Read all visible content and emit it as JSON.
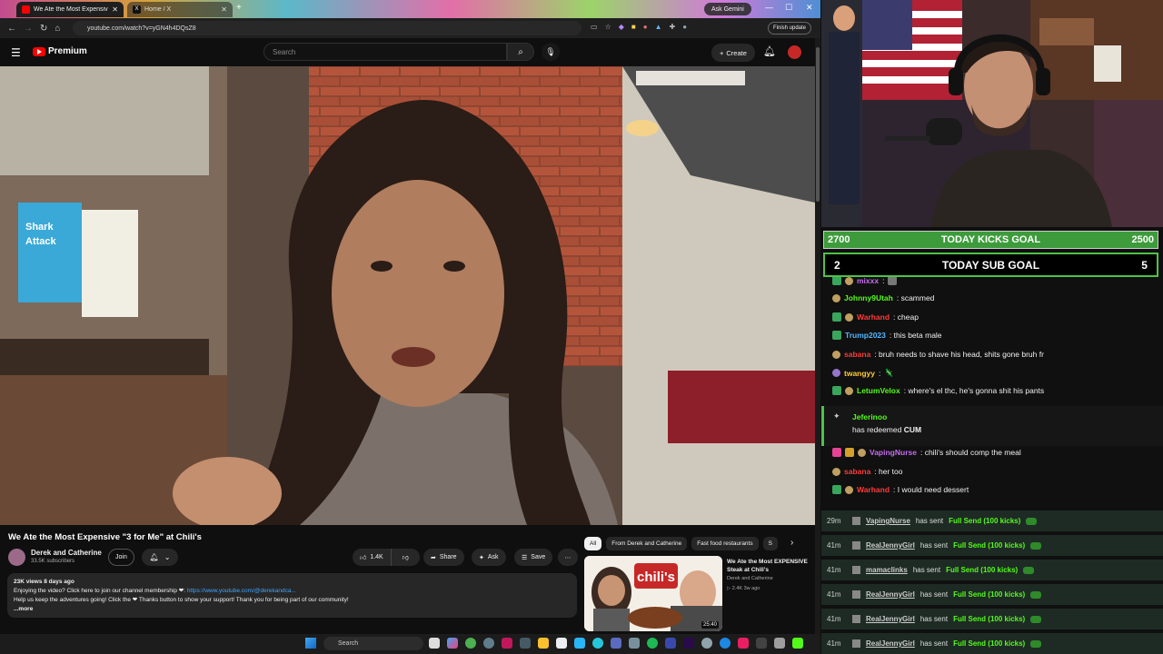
{
  "browser": {
    "tabs": [
      {
        "title": "We Ate the Most Expensive",
        "favicon_color": "#ff0000",
        "active": true
      },
      {
        "title": "Home / X",
        "favicon_color": "#222222",
        "active": false
      }
    ],
    "gemini_label": "Ask Gemini",
    "url": "youtube.com/watch?v=yGN4h4DQsZ8",
    "finish_update": "Finish update"
  },
  "youtube": {
    "logo_text": "Premium",
    "search_placeholder": "Search",
    "create_label": "Create",
    "video": {
      "title": "We Ate the Most Expensive \"3 for Me\" at Chili's",
      "channel": "Derek and Catherine",
      "subscribers": "33.5K subscribers",
      "join_label": "Join",
      "likes": "1.4K",
      "share_label": "Share",
      "ask_label": "Ask",
      "save_label": "Save"
    },
    "description": {
      "meta": "23K views  8 days ago",
      "line1_prefix": "Enjoying the video? Click here to join our channel membership ❤: ",
      "line1_link": "https://www.youtube.com/@derekandca...",
      "line2": "Help us keep the adventures going! Click the ❤ Thanks button to show your support! Thank you for being part of our community!",
      "more": "...more"
    },
    "chips": [
      "All",
      "From Derek and Catherine",
      "Fast food restaurants",
      "S"
    ],
    "recommendation": {
      "title": "We Ate the Most EXPENSIVE Steak at Chili's",
      "channel": "Derek and Catherine",
      "meta": "▷ 2.4K  3w ago",
      "duration": "25:40",
      "brand_text": "chili's"
    }
  },
  "goals": {
    "kicks": {
      "left": "2700",
      "label": "TODAY KICKS GOAL",
      "right": "2500"
    },
    "subs": {
      "left": "2",
      "label": "TODAY SUB GOAL",
      "right": "5"
    }
  },
  "chat": [
    {
      "user": "mixxx",
      "color": "#c56cf0",
      "text": ":",
      "badge": "#4caf50"
    },
    {
      "user": "Johnny9Utah",
      "color": "#53fc18",
      "text": ": scammed",
      "badge": ""
    },
    {
      "user": "Warhand",
      "color": "#ff3b3b",
      "text": ": cheap",
      "badge": "#3aa55c"
    },
    {
      "user": "Trump2023",
      "color": "#53b7ff",
      "text": ": this beta male",
      "badge": "#3aa55c"
    },
    {
      "user": "sabana",
      "color": "#ff3b3b",
      "text": ": bruh needs to shave his head, shits gone bruh fr",
      "badge": ""
    },
    {
      "user": "twangyy",
      "color": "#ffcc33",
      "text": ":",
      "badge": ""
    },
    {
      "user": "LetumVelox",
      "color": "#53fc18",
      "text": ": where's el thc, he's gonna shit his pants",
      "badge": "#3aa55c"
    },
    {
      "user": "VapingNurse",
      "color": "#c56cf0",
      "text": ": chili's should comp the meal",
      "badge": "#e84393"
    },
    {
      "user": "sabana",
      "color": "#ff3b3b",
      "text": ": her too",
      "badge": ""
    },
    {
      "user": "Warhand",
      "color": "#ff3b3b",
      "text": ": I would need dessert",
      "badge": "#3aa55c"
    }
  ],
  "redemption": {
    "user": "Jeferinoo",
    "text": "has redeemed",
    "reward": "CUM"
  },
  "feed": [
    {
      "time": "29m",
      "user": "VapingNurse",
      "text": "has sent",
      "gift": "Full Send (100 kicks)"
    },
    {
      "time": "41m",
      "user": "RealJennyGirl",
      "text": "has sent",
      "gift": "Full Send (100 kicks)"
    },
    {
      "time": "41m",
      "user": "mamaclinks",
      "text": "has sent",
      "gift": "Full Send (100 kicks)"
    },
    {
      "time": "41m",
      "user": "RealJennyGirl",
      "text": "has sent",
      "gift": "Full Send (100 kicks)"
    },
    {
      "time": "41m",
      "user": "RealJennyGirl",
      "text": "has sent",
      "gift": "Full Send (100 kicks)"
    },
    {
      "time": "41m",
      "user": "RealJennyGirl",
      "text": "has sent",
      "gift": "Full Send (100 kicks)"
    }
  ],
  "taskbar": {
    "search_label": "Search"
  }
}
